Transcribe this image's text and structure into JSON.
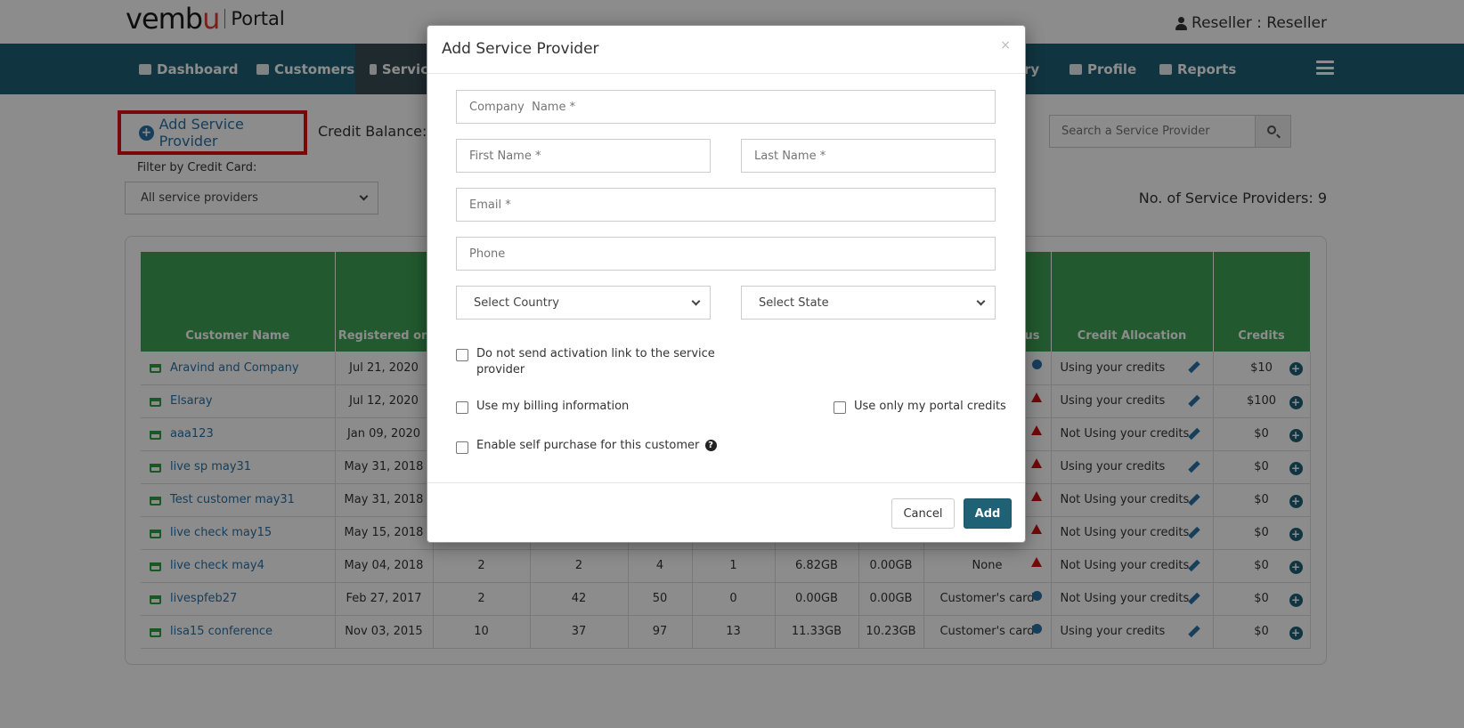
{
  "header": {
    "logo_brand_prefix": "vemb",
    "logo_brand_accent": "u",
    "logo_product": "Portal",
    "user_label": "Reseller : Reseller"
  },
  "nav": {
    "items": [
      {
        "label": "Dashboard",
        "icon": "dashboard-icon"
      },
      {
        "label": "Customers",
        "icon": "users-icon"
      },
      {
        "label": "Servic",
        "icon": "users-icon"
      },
      {
        "label": "ry",
        "icon": "history-icon"
      },
      {
        "label": "Profile",
        "icon": "profile-icon"
      },
      {
        "label": "Reports",
        "icon": "reports-icon"
      }
    ],
    "menu_icon": "hamburger-icon"
  },
  "page": {
    "add_button_label": "Add Service Provider",
    "credit_balance_label": "Credit Balance: $",
    "filter_label": "Filter by Credit Card:",
    "filter_selected": "All service providers",
    "search_placeholder": "Search a Service Provider",
    "count_label": "No. of Service Providers: 9"
  },
  "table": {
    "headers": [
      "Customer Name",
      "Registered on",
      "",
      "",
      "",
      "",
      "",
      "",
      "us",
      "Credit Allocation",
      "Credits"
    ],
    "rows": [
      {
        "name": "Aravind and Company",
        "registered": "Jul 21, 2020",
        "c3": "",
        "c4": "",
        "c5": "",
        "c6": "",
        "c7": "",
        "c8": "",
        "status": "",
        "status_icon": "ok",
        "allocation": "Using your credits",
        "credits": "$10"
      },
      {
        "name": "Elsaray",
        "registered": "Jul 12, 2020",
        "c3": "",
        "c4": "",
        "c5": "",
        "c6": "",
        "c7": "",
        "c8": "",
        "status": "",
        "status_icon": "warn",
        "allocation": "Using your credits",
        "credits": "$100"
      },
      {
        "name": "aaa123",
        "registered": "Jan 09, 2020",
        "c3": "",
        "c4": "",
        "c5": "",
        "c6": "",
        "c7": "",
        "c8": "",
        "status": "",
        "status_icon": "warn",
        "allocation": "Not Using your credits",
        "credits": "$0"
      },
      {
        "name": "live sp may31",
        "registered": "May 31, 2018",
        "c3": "",
        "c4": "",
        "c5": "",
        "c6": "",
        "c7": "",
        "c8": "",
        "status": "",
        "status_icon": "warn",
        "allocation": "Using your credits",
        "credits": "$0"
      },
      {
        "name": "Test customer may31",
        "registered": "May 31, 2018",
        "c3": "",
        "c4": "",
        "c5": "",
        "c6": "",
        "c7": "",
        "c8": "",
        "status": "",
        "status_icon": "warn",
        "allocation": "Not Using your credits",
        "credits": "$0"
      },
      {
        "name": "live check may15",
        "registered": "May 15, 2018",
        "c3": "",
        "c4": "",
        "c5": "",
        "c6": "",
        "c7": "",
        "c8": "",
        "status": "",
        "status_icon": "warn",
        "allocation": "Not Using your credits",
        "credits": "$0"
      },
      {
        "name": "live check may4",
        "registered": "May 04, 2018",
        "c3": "2",
        "c4": "2",
        "c5": "4",
        "c6": "1",
        "c7": "6.82GB",
        "c8": "0.00GB",
        "status": "None",
        "status_icon": "warn",
        "allocation": "Not Using your credits",
        "credits": "$0"
      },
      {
        "name": "livespfeb27",
        "registered": "Feb 27, 2017",
        "c3": "2",
        "c4": "42",
        "c5": "50",
        "c6": "0",
        "c7": "0.00GB",
        "c8": "0.00GB",
        "status": "Customer's card",
        "status_icon": "ok",
        "allocation": "Not Using your credits",
        "credits": "$0"
      },
      {
        "name": "lisa15 conference",
        "registered": "Nov 03, 2015",
        "c3": "10",
        "c4": "37",
        "c5": "97",
        "c6": "13",
        "c7": "11.33GB",
        "c8": "10.23GB",
        "status": "Customer's card",
        "status_icon": "ok",
        "allocation": "Using your credits",
        "credits": "$0"
      }
    ]
  },
  "modal": {
    "title": "Add Service Provider",
    "close_glyph": "×",
    "company_placeholder": "Company  Name *",
    "first_name_placeholder": "First Name *",
    "last_name_placeholder": "Last Name *",
    "email_placeholder": "Email *",
    "phone_placeholder": "Phone",
    "country_selected": "Select Country",
    "state_selected": "Select State",
    "chk_no_activation_line1": "Do not send activation link to the service",
    "chk_no_activation_line2": "provider",
    "chk_billing": "Use my billing information",
    "chk_portal_credits": "Use only my portal credits",
    "chk_self_purchase": "Enable self purchase for this customer",
    "help_glyph": "?",
    "cancel_label": "Cancel",
    "add_label": "Add"
  },
  "colors": {
    "navbar": "#1f6276",
    "table_header": "#3ea354",
    "link": "#2a72a6",
    "highlight_border": "#e01010"
  }
}
